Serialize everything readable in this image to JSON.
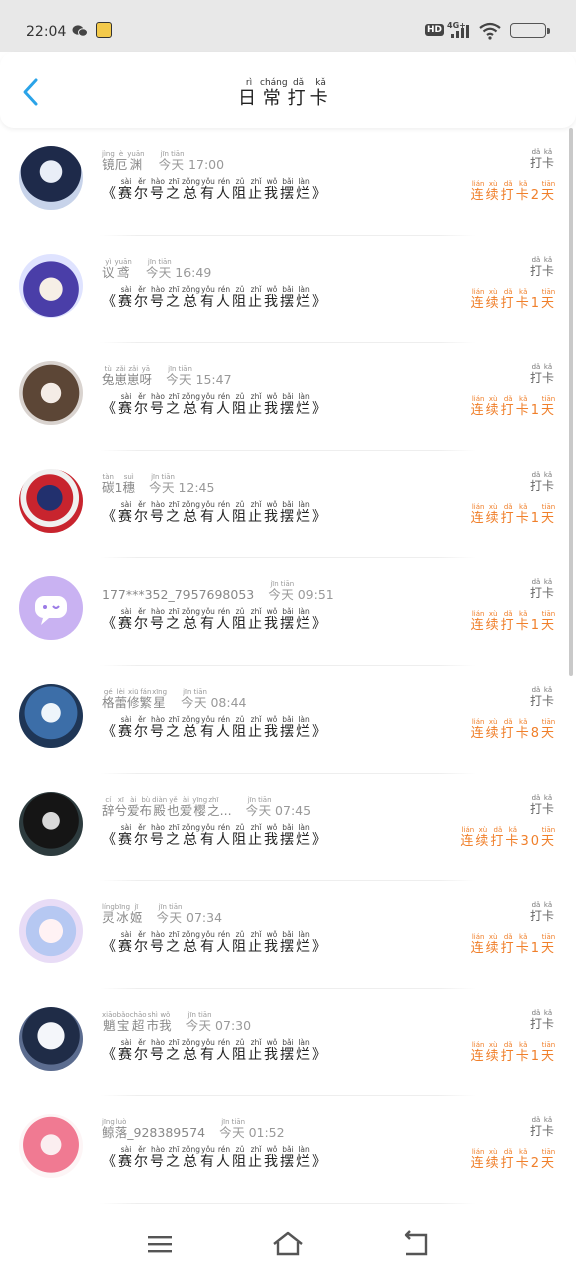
{
  "status_bar": {
    "time": "22:04",
    "network": "4G+",
    "hd": "HD",
    "icons": [
      "wechat-icon",
      "app-notification-icon",
      "hd-icon",
      "signal-icon",
      "wifi-icon",
      "battery-icon"
    ]
  },
  "header": {
    "title_chars": [
      {
        "ch": "日",
        "py": "rì"
      },
      {
        "ch": "常",
        "py": "cháng"
      },
      {
        "ch": "打",
        "py": "dǎ"
      },
      {
        "ch": "卡",
        "py": "kǎ"
      }
    ],
    "accent_color": "#2aa3e8"
  },
  "book_title": {
    "chars": [
      {
        "ch": "赛",
        "py": "sài"
      },
      {
        "ch": "尔",
        "py": "ěr"
      },
      {
        "ch": "号",
        "py": "hào"
      },
      {
        "ch": "之",
        "py": "zhī"
      },
      {
        "ch": "总",
        "py": "zǒng"
      },
      {
        "ch": "有",
        "py": "yǒu"
      },
      {
        "ch": "人",
        "py": "rén"
      },
      {
        "ch": "阻",
        "py": "zǔ"
      },
      {
        "ch": "止",
        "py": "zhǐ"
      },
      {
        "ch": "我",
        "py": "wǒ"
      },
      {
        "ch": "摆",
        "py": "bǎi"
      },
      {
        "ch": "烂",
        "py": "làn"
      }
    ],
    "open": "《",
    "close": "》"
  },
  "checkin_label": [
    {
      "ch": "打",
      "py": "dǎ"
    },
    {
      "ch": "卡",
      "py": "kǎ"
    }
  ],
  "today": [
    {
      "ch": "今",
      "py": "jīn"
    },
    {
      "ch": "天",
      "py": "tiān"
    }
  ],
  "streak_prefix": [
    {
      "ch": "连",
      "py": "lián"
    },
    {
      "ch": "续",
      "py": "xù"
    },
    {
      "ch": "打",
      "py": "dǎ"
    },
    {
      "ch": "卡",
      "py": "kǎ"
    }
  ],
  "streak_suffix": {
    "ch": "天",
    "py": "tiān"
  },
  "streak_color": "#f07f2a",
  "entries": [
    {
      "name": [
        {
          "ch": "镜",
          "py": "jìng"
        },
        {
          "ch": "厄",
          "py": "è"
        },
        {
          "ch": "渊",
          "py": "yuān"
        }
      ],
      "time": "17:00",
      "days": "2",
      "avatar": "avatar-dark-hair-girl"
    },
    {
      "name": [
        {
          "ch": "议",
          "py": "yì"
        },
        {
          "ch": "鸢",
          "py": "yuān"
        }
      ],
      "time": "16:49",
      "days": "1",
      "avatar": "avatar-purple-hair-chibi"
    },
    {
      "name": [
        {
          "ch": "兔",
          "py": "tù"
        },
        {
          "ch": "崽",
          "py": "zǎi"
        },
        {
          "ch": "崽",
          "py": "zǎi"
        },
        {
          "ch": "呀",
          "py": "yā"
        }
      ],
      "time": "15:47",
      "days": "1",
      "avatar": "avatar-brown-hair-girl"
    },
    {
      "name": [
        {
          "ch": "碳",
          "py": "tàn"
        },
        {
          "ch": "1",
          "py": ""
        },
        {
          "ch": "穗",
          "py": "suì"
        }
      ],
      "time": "12:45",
      "days": "1",
      "avatar": "avatar-flag-ball"
    },
    {
      "name_plain": "177***352_7957698053",
      "time": "09:51",
      "days": "1",
      "avatar": "avatar-default-chat"
    },
    {
      "name": [
        {
          "ch": "格",
          "py": "gé"
        },
        {
          "ch": "蕾",
          "py": "lèi"
        },
        {
          "ch": "修",
          "py": "xiū"
        },
        {
          "ch": "繁",
          "py": "fán"
        },
        {
          "ch": "星",
          "py": "xīng"
        }
      ],
      "time": "08:44",
      "days": "8",
      "avatar": "avatar-blue-hair-girl"
    },
    {
      "name": [
        {
          "ch": "辞",
          "py": "cí"
        },
        {
          "ch": "兮",
          "py": "xī"
        },
        {
          "ch": "爱",
          "py": "ài"
        },
        {
          "ch": "布",
          "py": "bù"
        },
        {
          "ch": "殿",
          "py": "diàn"
        },
        {
          "ch": "也",
          "py": "yě"
        },
        {
          "ch": "爱",
          "py": "ài"
        },
        {
          "ch": "樱",
          "py": "yīng"
        },
        {
          "ch": "之",
          "py": "zhī"
        },
        {
          "ch": "...",
          "py": ""
        }
      ],
      "time": "07:45",
      "days": "30",
      "avatar": "avatar-dark-character"
    },
    {
      "name": [
        {
          "ch": "灵",
          "py": "líng"
        },
        {
          "ch": "冰",
          "py": "bīng"
        },
        {
          "ch": "姬",
          "py": "jī"
        }
      ],
      "time": "07:34",
      "days": "1",
      "avatar": "avatar-pastel-girl"
    },
    {
      "name": [
        {
          "ch": "魈",
          "py": "xiāo"
        },
        {
          "ch": "宝",
          "py": "bǎo"
        },
        {
          "ch": "超",
          "py": "chāo"
        },
        {
          "ch": "市",
          "py": "shì"
        },
        {
          "ch": "我",
          "py": "wǒ"
        }
      ],
      "time": "07:30",
      "days": "1",
      "avatar": "avatar-white-hair-boy"
    },
    {
      "name_plain_head": [
        {
          "ch": "鲸",
          "py": "jīng"
        },
        {
          "ch": "落",
          "py": "luò"
        }
      ],
      "name_plain_tail": "_928389574",
      "time": "01:52",
      "days": "2",
      "avatar": "avatar-pink-hair-girl"
    }
  ],
  "nav": {
    "icons": [
      "menu-icon",
      "home-icon",
      "back-nav-icon"
    ]
  }
}
